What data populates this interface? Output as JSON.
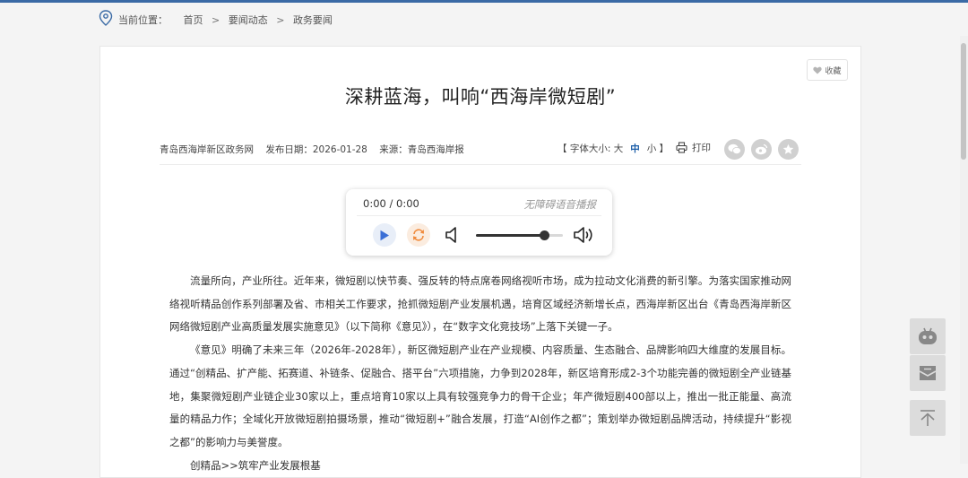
{
  "breadcrumb": {
    "label": "当前位置：",
    "items": [
      "首页",
      "要闻动态",
      "政务要闻"
    ],
    "separator": ">"
  },
  "favorite_label": "收藏",
  "article": {
    "title": "深耕蓝海，叫响“西海岸微短剧”",
    "site": "青岛西海岸新区政务网",
    "date": "发布日期：2026-01-28",
    "source": "来源：青岛西海岸报",
    "fontsize": {
      "open": "【 字体大小: 大",
      "mid": "中",
      "small": "小 】"
    },
    "print_label": "打印",
    "paragraphs": [
      "流量所向，产业所往。近年来，微短剧以快节奏、强反转的特点席卷网络视听市场，成为拉动文化消费的新引擎。为落实国家推动网络视听精品创作系列部署及省、市相关工作要求，抢抓微短剧产业发展机遇，培育区域经济新增长点，西海岸新区出台《青岛西海岸新区网络微短剧产业高质量发展实施意见》（以下简称《意见》），在“数字文化竞技场”上落下关键一子。",
      "《意见》明确了未来三年（2026年-2028年），新区微短剧产业在产业规模、内容质量、生态融合、品牌影响四大维度的发展目标。通过“创精品、扩产能、拓赛道、补链条、促融合、搭平台”六项措施，力争到2028年，新区培育形成2-3个功能完善的微短剧全产业链基地，集聚微短剧产业链企业30家以上，重点培育10家以上具有较强竞争力的骨干企业；年产微短剧400部以上，推出一批正能量、高流量的精品力作；全域化开放微短剧拍摄场景，推动“微短剧+”融合发展，打造“AI创作之都”；策划举办微短剧品牌活动，持续提升“影视之都”的影响力与美誉度。",
      "创精品>>筑牢产业发展根基"
    ]
  },
  "audio_player": {
    "time": "0:00 / 0:00",
    "hint": "无障碍语音播报",
    "volume": 0.78,
    "play_color": "#3b6fd6",
    "loop_color": "#f08a3c"
  },
  "share_icons": [
    "wechat-icon",
    "weibo-icon",
    "favorite-star-icon"
  ],
  "side_tools": [
    "robot-assistant-icon",
    "message-icon",
    "back-to-top-icon"
  ]
}
